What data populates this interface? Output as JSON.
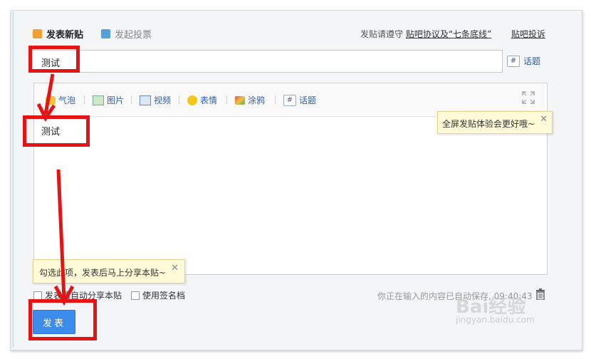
{
  "tabs": {
    "new_post": "发表新贴",
    "vote": "发起投票"
  },
  "notice": {
    "prefix": "发贴请遵守 ",
    "link": "贴吧协议及“七条底线”"
  },
  "report_link": "贴吧投诉",
  "title_input": {
    "value": "测试"
  },
  "topic_label": "话题",
  "toolbar": {
    "items": [
      {
        "label": "气泡",
        "icon": "bubble-icon"
      },
      {
        "label": "图片",
        "icon": "image-icon"
      },
      {
        "label": "视频",
        "icon": "video-icon"
      },
      {
        "label": "表情",
        "icon": "emoji-icon"
      },
      {
        "label": "涂鸦",
        "icon": "paint-icon"
      },
      {
        "label": "话题",
        "icon": "hash-icon"
      }
    ]
  },
  "editor": {
    "content": "测试"
  },
  "tips": {
    "fullscreen": "全屏发贴体验会更好哦~",
    "share": "勾选此项，发表后马上分享本贴~",
    "close": "✕"
  },
  "options": {
    "auto_share": "发表后自动分享本贴",
    "signature": "使用签名档"
  },
  "autosave": "你正在输入的内容已自动保存, 09:40:43",
  "submit_label": "发表",
  "watermark": {
    "brand": "Bai经验",
    "url": "jingyan.baidu.com"
  },
  "colors": {
    "accent": "#3b8ced",
    "annotation": "#e41414",
    "link": "#2f5ea8"
  }
}
